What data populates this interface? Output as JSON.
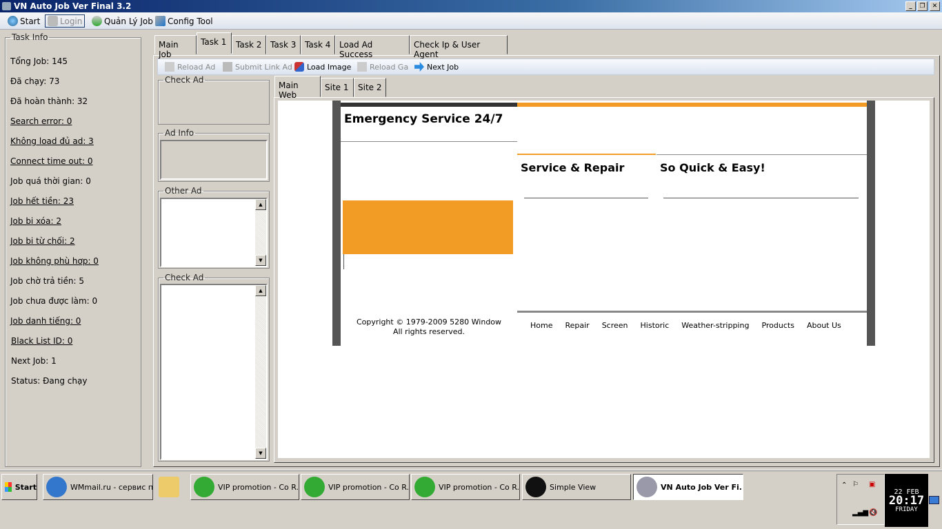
{
  "window": {
    "title": "VN Auto Job Ver Final 3.2",
    "min": "_",
    "restore": "❐",
    "close": "✕"
  },
  "toolbar": {
    "start": "Start",
    "login": "Login",
    "manage": "Quản Lý Job",
    "config": "Config Tool"
  },
  "task_info": {
    "legend": "Task Info",
    "items": [
      {
        "text": "Tổng Job: 145",
        "link": false
      },
      {
        "text": "Đã chạy: 73",
        "link": false
      },
      {
        "text": "Đã hoàn thành: 32",
        "link": false
      },
      {
        "text": "Search error: 0",
        "link": true
      },
      {
        "text": "Không load đủ ad: 3",
        "link": true
      },
      {
        "text": "Connect time out: 0",
        "link": true
      },
      {
        "text": "Job quá thời gian: 0",
        "link": false
      },
      {
        "text": "Job hết tiền: 23",
        "link": true
      },
      {
        "text": "Job bi xóa: 2",
        "link": true
      },
      {
        "text": "Job bi từ chối: 2",
        "link": true
      },
      {
        "text": "Job không phù hơp: 0",
        "link": true
      },
      {
        "text": "Job chờ trả tiền: 5",
        "link": false
      },
      {
        "text": "Job chưa được làm: 0",
        "link": false
      },
      {
        "text": "Job danh tiếng: 0",
        "link": true
      },
      {
        "text": "Black List ID: 0",
        "link": true
      },
      {
        "text": "Next Job: 1",
        "link": false
      },
      {
        "text": "Status: Đang chạy",
        "link": false
      }
    ]
  },
  "tabs": [
    "Main Job",
    "Task 1",
    "Task 2",
    "Task 3",
    "Task 4",
    "Load Ad Success",
    "Check Ip & User Agent"
  ],
  "inner_toolbar": {
    "reload_ad": "Reload Ad",
    "submit_link_ad": "Submit Link Ad",
    "load_image": "Load Image",
    "reload_ga": "Reload Ga",
    "next_job": "Next Job"
  },
  "groups": {
    "check_ad_1": "Check Ad",
    "ad_info": "Ad Info",
    "other_ad": "Other Ad",
    "check_ad_2": "Check Ad"
  },
  "browser_tabs": [
    "Main Web",
    "Site 1",
    "Site 2"
  ],
  "web": {
    "heading": "Emergency Service 24/7",
    "col1": "Service & Repair",
    "col2": "So Quick & Easy!",
    "copyright1": "Copyright © 1979-2009 5280 Window",
    "copyright2": "All rights reserved.",
    "nav": [
      "Home",
      "Repair",
      "Screen",
      "Historic",
      "Weather-stripping",
      "Products",
      "About Us"
    ],
    "accent": "#f29c26"
  },
  "taskbar": {
    "start": "Start",
    "tasks": [
      "WMmail.ru - сервис п...",
      "VIP promotion - Co R...",
      "VIP promotion - Co R...",
      "VIP promotion - Co R...",
      "Simple View",
      "VN Auto Job Ver Fi..."
    ],
    "clock": {
      "date": "22 FEB",
      "time": "20:17",
      "day": "FRIDAY"
    }
  }
}
